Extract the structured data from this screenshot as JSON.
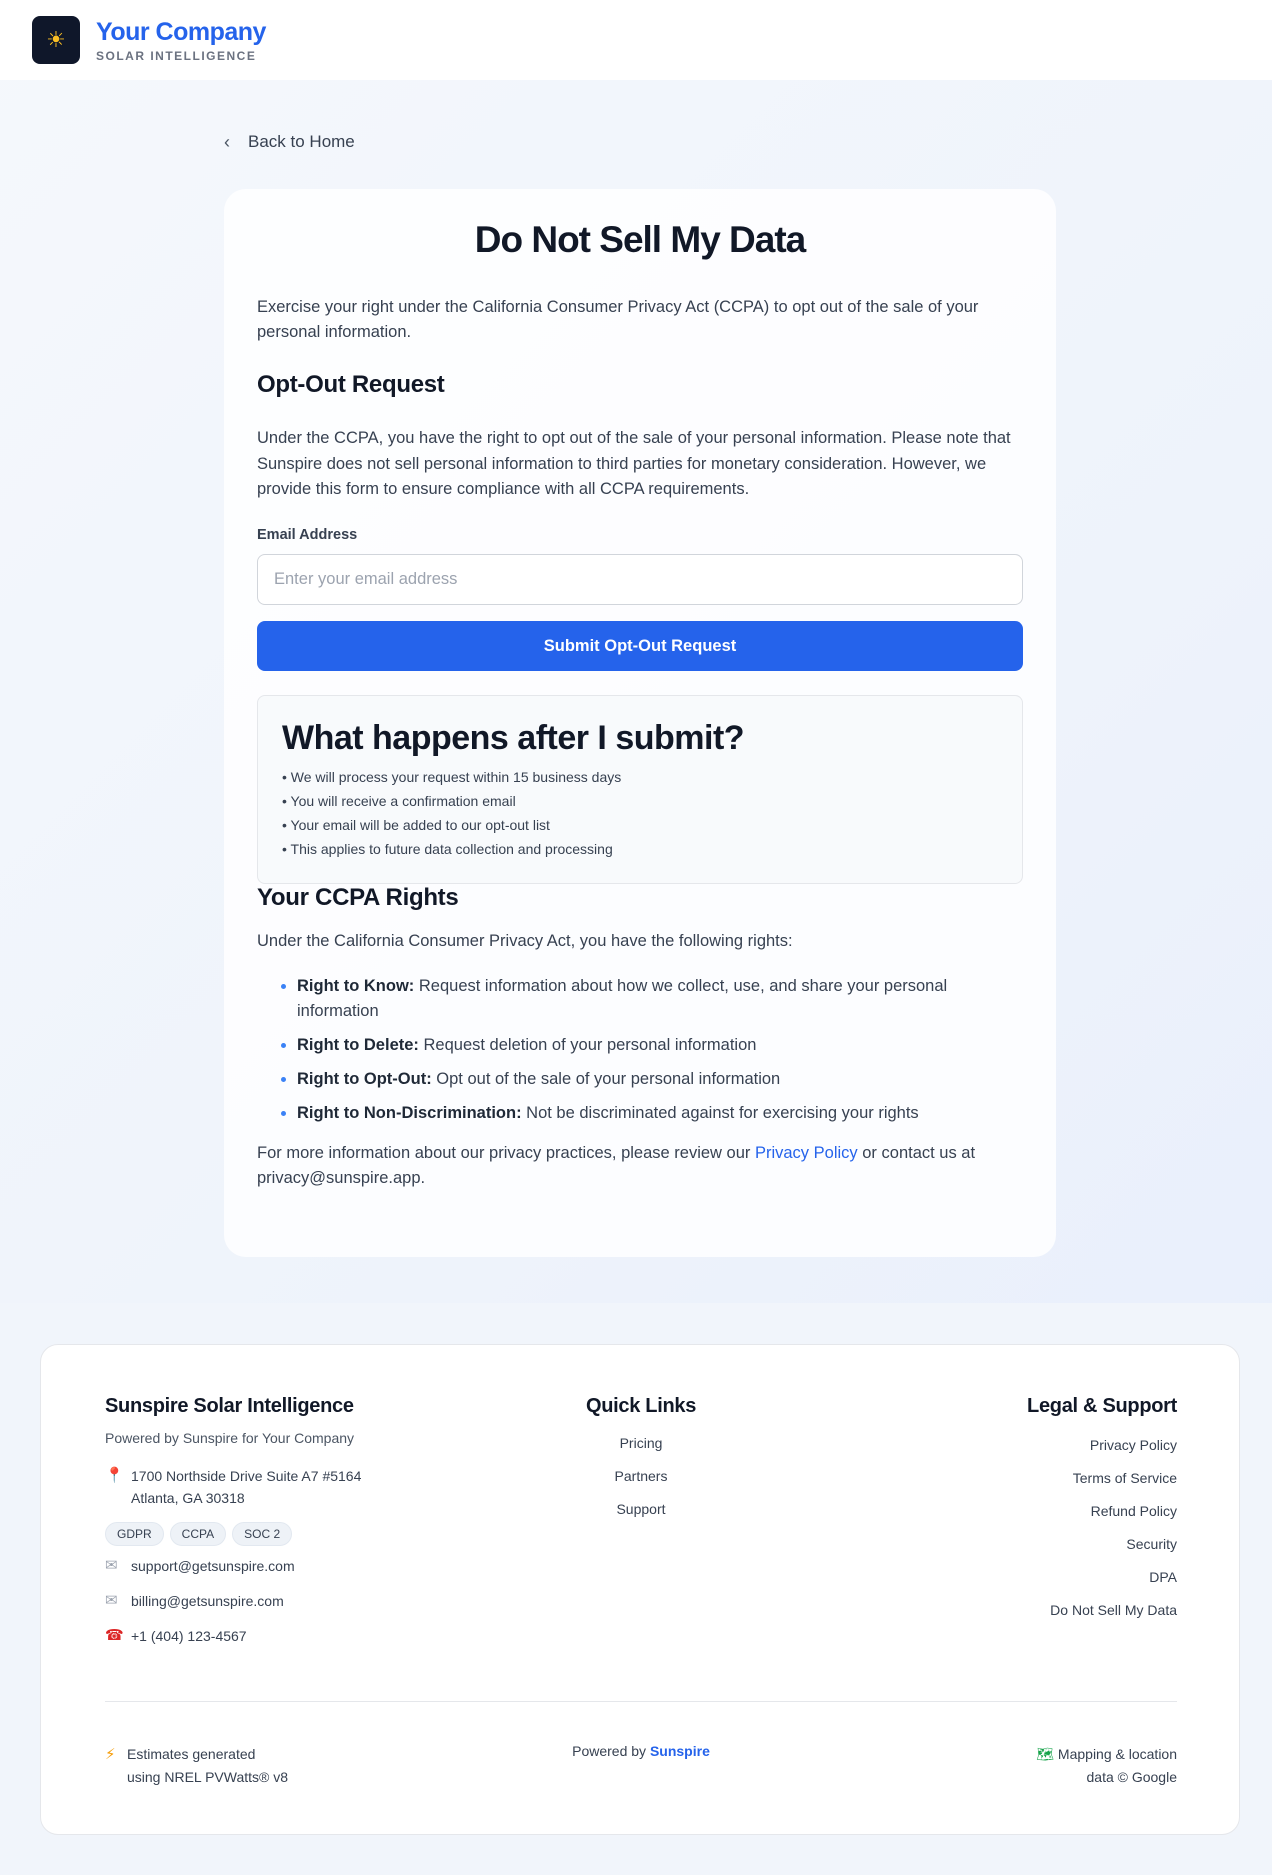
{
  "header": {
    "logo_icon": "sun-icon",
    "brand_name": "Your Company",
    "brand_tagline": "SOLAR INTELLIGENCE",
    "brand_color": "#2563eb"
  },
  "nav": {
    "back_label": "Back to Home"
  },
  "page": {
    "title": "Do Not Sell My Data",
    "intro": "Exercise your right under the California Consumer Privacy Act (CCPA) to opt out of the sale of your personal information.",
    "optout": {
      "title": "Opt-Out Request",
      "body": "Under the CCPA, you have the right to opt out of the sale of your personal information. Please note that Sunspire does not sell personal information to third parties for monetary consideration. However, we provide this form to ensure compliance with all CCPA requirements.",
      "email_label": "Email Address",
      "email_placeholder": "Enter your email address",
      "email_value": "",
      "submit_label": "Submit Opt-Out Request"
    },
    "after_submit": {
      "title": "What happens after I submit?",
      "items": [
        "• We will process your request within 15 business days",
        "• You will receive a confirmation email",
        "• Your email will be added to our opt-out list",
        "• This applies to future data collection and processing"
      ]
    },
    "rights": {
      "title": "Your CCPA Rights",
      "intro": "Under the California Consumer Privacy Act, you have the following rights:",
      "items": [
        {
          "label": "Right to Know:",
          "text": " Request information about how we collect, use, and share your personal information"
        },
        {
          "label": "Right to Delete:",
          "text": " Request deletion of your personal information"
        },
        {
          "label": "Right to Opt-Out:",
          "text": " Opt out of the sale of your personal information"
        },
        {
          "label": "Right to Non-Discrimination:",
          "text": " Not be discriminated against for exercising your rights"
        }
      ]
    },
    "more_info": {
      "before": "For more information about our privacy practices, please review our ",
      "link": "Privacy Policy",
      "after": " or contact us at privacy@sunspire.app."
    }
  },
  "footer": {
    "company": {
      "title": "Sunspire Solar Intelligence",
      "subtitle": "Powered by Sunspire for Your Company",
      "address_line1": "1700 Northside Drive Suite A7 #5164",
      "address_line2": "Atlanta, GA 30318",
      "badges": [
        "GDPR",
        "CCPA",
        "SOC 2"
      ],
      "support_email": "support@getsunspire.com",
      "billing_email": "billing@getsunspire.com",
      "phone": "+1 (404) 123-4567"
    },
    "quick_links": {
      "title": "Quick Links",
      "items": [
        "Pricing",
        "Partners",
        "Support"
      ]
    },
    "legal": {
      "title": "Legal & Support",
      "items": [
        "Privacy Policy",
        "Terms of Service",
        "Refund Policy",
        "Security",
        "DPA",
        "Do Not Sell My Data"
      ]
    },
    "bottom": {
      "estimates_line1": "Estimates generated",
      "estimates_line2": "using NREL PVWatts® v8",
      "powered_by": "Powered by ",
      "powered_brand": "Sunspire",
      "mapping_line1": "Mapping & location",
      "mapping_line2": "data © Google"
    }
  }
}
